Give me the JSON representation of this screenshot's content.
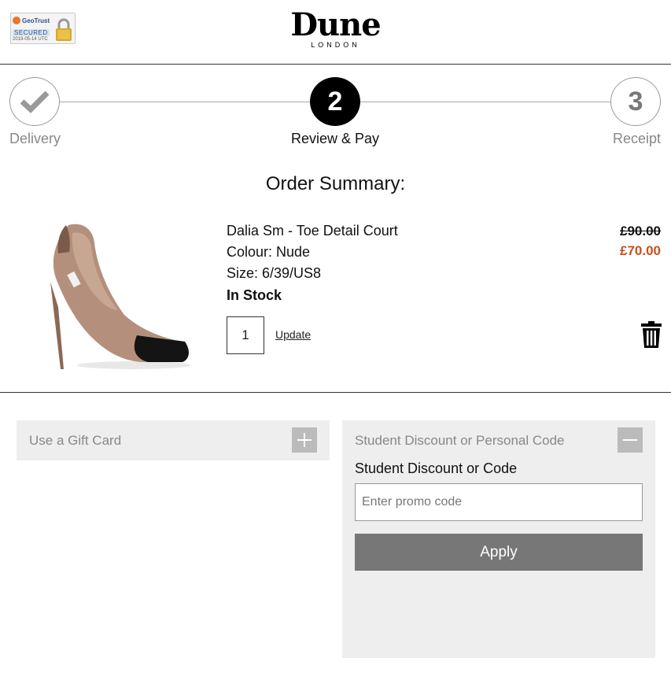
{
  "header": {
    "badge": {
      "brand": "GeoTrust",
      "secured": "SECURED",
      "date": "2019-05-14 UTC"
    },
    "logo": {
      "word": "Dune",
      "sub": "LONDON"
    }
  },
  "steps": [
    {
      "label": "Delivery",
      "number": "",
      "state": "done"
    },
    {
      "label": "Review & Pay",
      "number": "2",
      "state": "active"
    },
    {
      "label": "Receipt",
      "number": "3",
      "state": "pending"
    }
  ],
  "summary": {
    "title": "Order Summary:"
  },
  "product": {
    "name": "Dalia Sm - Toe Detail Court",
    "colour": "Colour: Nude",
    "size": "Size: 6/39/US8",
    "stock": "In Stock",
    "price_was": "£90.00",
    "price_now": "£70.00",
    "quantity": "1",
    "update_label": "Update"
  },
  "gift_card": {
    "label": "Use a Gift Card"
  },
  "promo": {
    "header": "Student Discount or Personal Code",
    "label": "Student Discount or Code",
    "placeholder": "Enter promo code",
    "apply_label": "Apply"
  },
  "colors": {
    "sale_price": "#c8501a",
    "panel_bg": "#eeeeee",
    "apply_bg": "#777777",
    "toggle_bg": "#bbbbbb"
  }
}
